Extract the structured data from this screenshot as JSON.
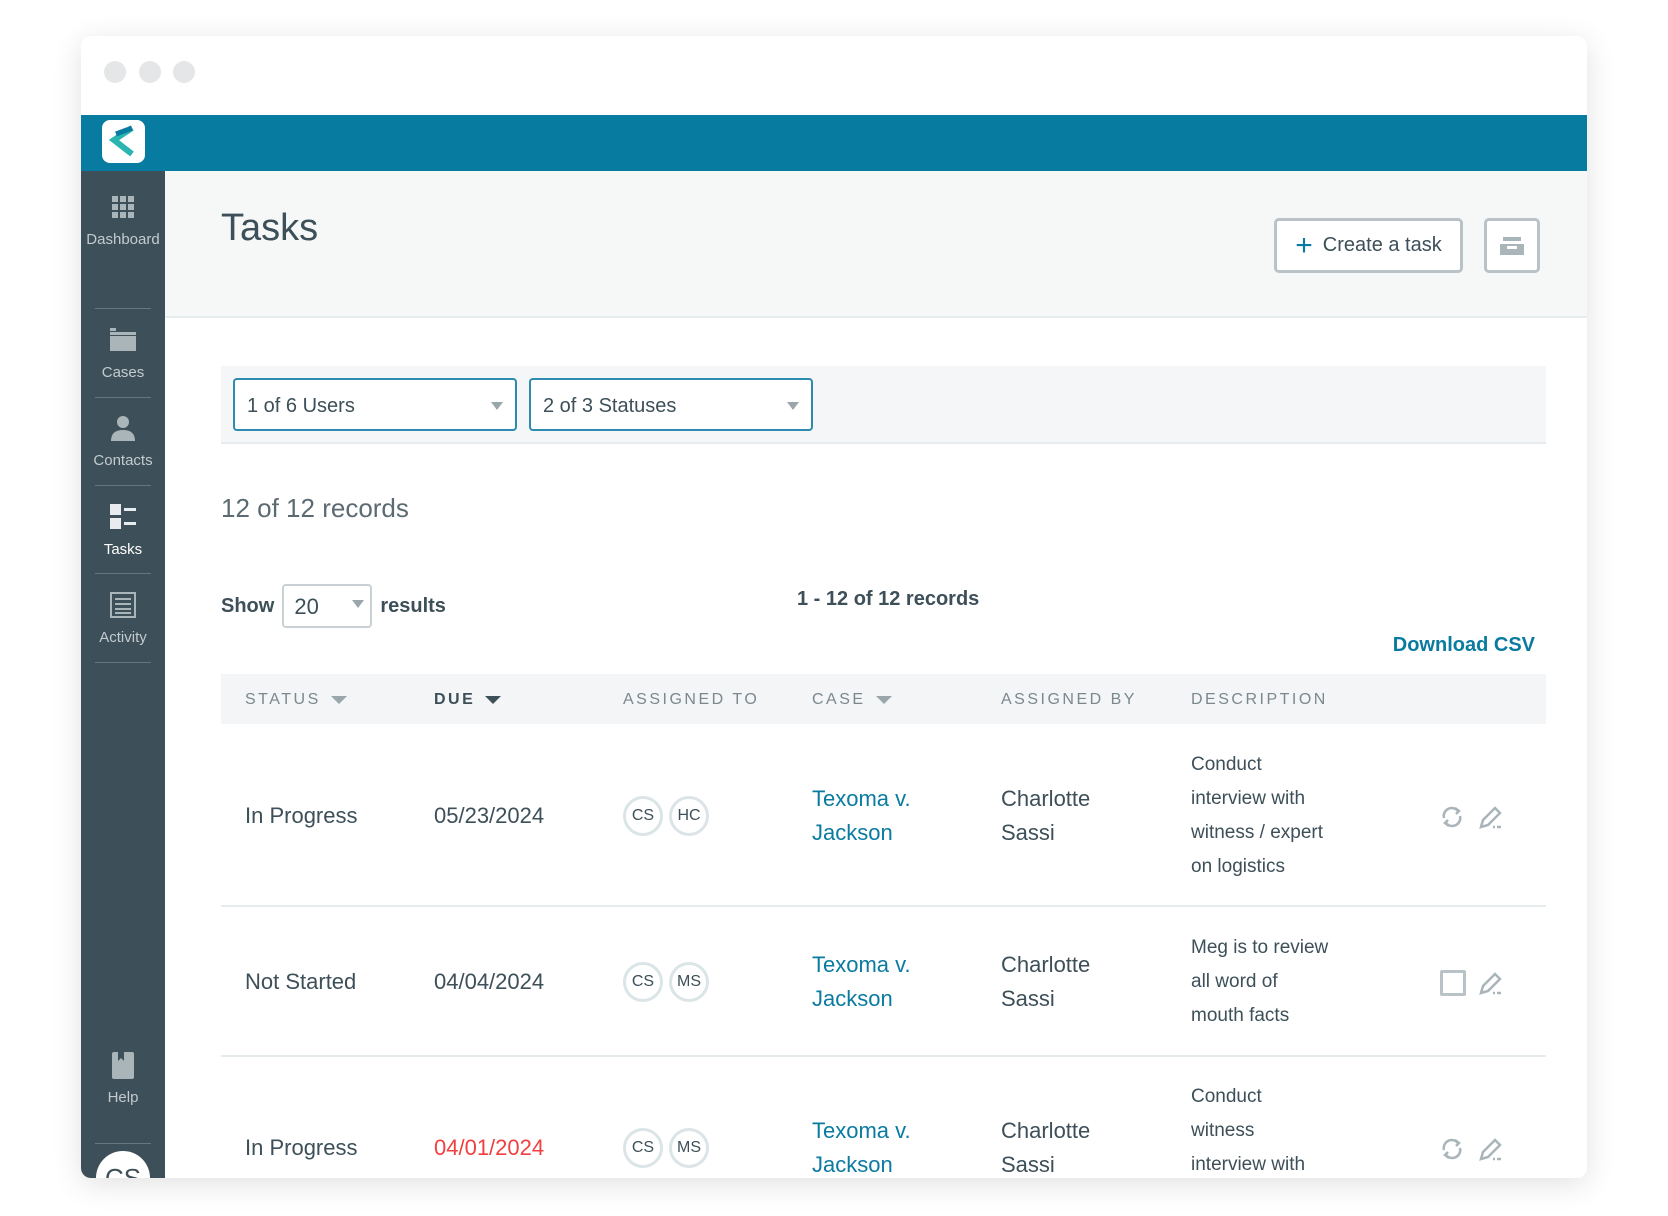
{
  "sidebar": {
    "items": [
      {
        "label": "Dashboard",
        "icon": "grid-icon"
      },
      {
        "label": "Cases",
        "icon": "folder-icon"
      },
      {
        "label": "Contacts",
        "icon": "person-icon"
      },
      {
        "label": "Tasks",
        "icon": "tasks-icon",
        "active": true
      },
      {
        "label": "Activity",
        "icon": "list-icon"
      },
      {
        "label": "Help",
        "icon": "book-icon"
      }
    ],
    "avatar": "CS"
  },
  "header": {
    "title": "Tasks",
    "create_label": "Create a task",
    "print_icon": "print-icon"
  },
  "filters": {
    "users": "1 of 6 Users",
    "statuses": "2 of 3 Statuses"
  },
  "records_count": "12 of 12 records",
  "pagination": {
    "show_label": "Show",
    "page_size": "20",
    "results_label": "results",
    "range": "1 - 12 of 12 records"
  },
  "download_csv": "Download CSV",
  "table": {
    "headers": [
      "STATUS",
      "DUE",
      "ASSIGNED TO",
      "CASE",
      "ASSIGNED BY",
      "DESCRIPTION"
    ],
    "rows": [
      {
        "status": "In Progress",
        "due": "05/23/2024",
        "overdue": false,
        "assigned": [
          "CS",
          "HC"
        ],
        "case1": "Texoma v.",
        "case2": "Jackson",
        "by1": "Charlotte",
        "by2": "Sassi",
        "desc": [
          "Conduct",
          "interview with",
          "witness / expert",
          "on logistics"
        ],
        "action": "refresh-icon"
      },
      {
        "status": "Not Started",
        "due": "04/04/2024",
        "overdue": false,
        "assigned": [
          "CS",
          "MS"
        ],
        "case1": "Texoma v.",
        "case2": "Jackson",
        "by1": "Charlotte",
        "by2": "Sassi",
        "desc": [
          "Meg is to review",
          "all word of",
          "mouth facts"
        ],
        "action": "checkbox-icon"
      },
      {
        "status": "In Progress",
        "due": "04/01/2024",
        "overdue": true,
        "assigned": [
          "CS",
          "MS"
        ],
        "case1": "Texoma v.",
        "case2": "Jackson",
        "by1": "Charlotte",
        "by2": "Sassi",
        "desc": [
          "Conduct",
          "witness",
          "interview with"
        ],
        "action": "refresh-icon"
      }
    ]
  },
  "colors": {
    "brand": "#087ba0",
    "sidebar": "#3d4f58",
    "link": "#0a7ba0",
    "overdue": "#f0403f"
  }
}
